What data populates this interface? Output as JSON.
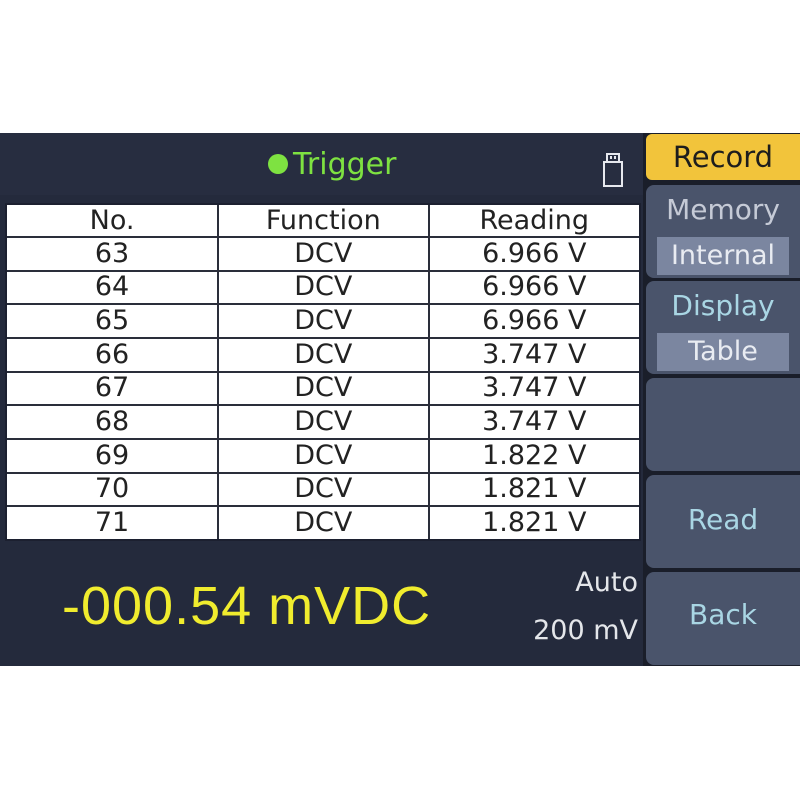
{
  "header": {
    "trigger_label": "Trigger",
    "trigger_color": "#7ee241",
    "storage_icon": "usb-drive-icon"
  },
  "table": {
    "columns": [
      "No.",
      "Function",
      "Reading"
    ],
    "rows": [
      [
        "63",
        "DCV",
        "6.966 V"
      ],
      [
        "64",
        "DCV",
        "6.966 V"
      ],
      [
        "65",
        "DCV",
        "6.966 V"
      ],
      [
        "66",
        "DCV",
        "3.747 V"
      ],
      [
        "67",
        "DCV",
        "3.747 V"
      ],
      [
        "68",
        "DCV",
        "3.747 V"
      ],
      [
        "69",
        "DCV",
        "1.822 V"
      ],
      [
        "70",
        "DCV",
        "1.821 V"
      ],
      [
        "71",
        "DCV",
        "1.821 V"
      ]
    ]
  },
  "measurement": {
    "value": "-000.54 mVDC",
    "range_mode": "Auto",
    "range": "200 mV",
    "value_color": "#f0ec2e"
  },
  "softkeys": {
    "title": "Record",
    "memory_label": "Memory",
    "memory_value": "Internal",
    "display_label": "Display",
    "display_value": "Table",
    "blank_label": "",
    "read_label": "Read",
    "back_label": "Back",
    "title_color": "#f2c43b"
  }
}
